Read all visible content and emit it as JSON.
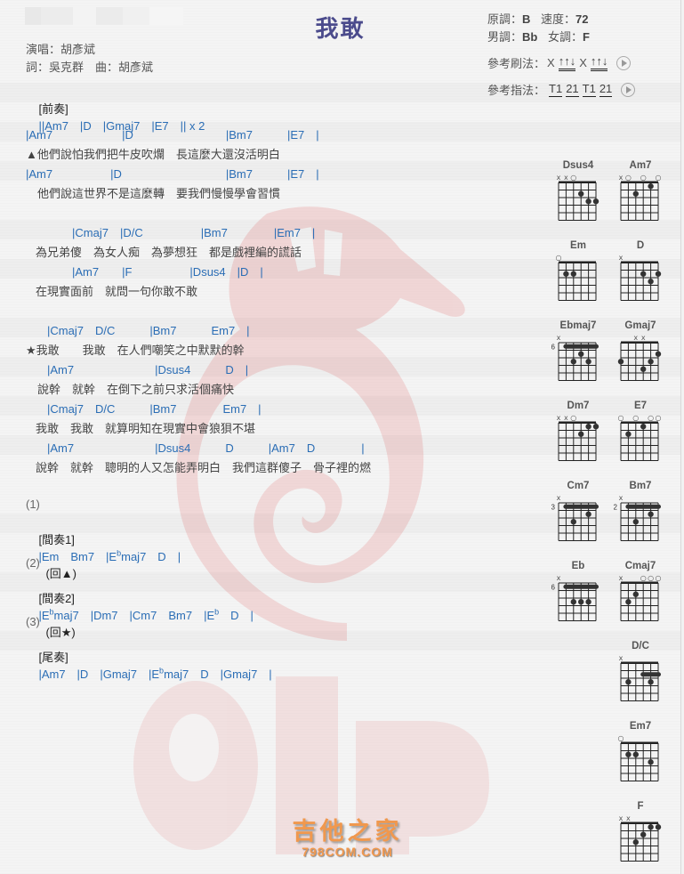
{
  "song": {
    "title": "我敢",
    "singer_line": "演唱：胡彥斌",
    "credits_line": "詞：吳克群　曲：胡彥斌"
  },
  "key_info": {
    "original_key_label": "原調：",
    "original_key": "B",
    "tempo_label": "速度：",
    "tempo": "72",
    "male_key_label": "男調：",
    "male_key": "Bb",
    "female_key_label": "女調：",
    "female_key": "F"
  },
  "strumming": {
    "label": "參考刷法：",
    "pattern": [
      "X",
      "↑↑↓",
      "X",
      "↑↑↓"
    ],
    "play_icon": "play-circle-icon"
  },
  "fingering": {
    "label": "參考指法：",
    "pattern": [
      "T1",
      "21",
      "T1",
      "21"
    ],
    "play_icon": "play-circle-icon"
  },
  "sheet": {
    "intro": {
      "label": "[前奏]",
      "chords": "||Am7　|D　|Gmaj7　|E7　|| x 2"
    },
    "verse": [
      {
        "chords": "|Am7　　　　　　|D　　　　　　　　|Bm7　　　|E7　|",
        "lyric": "▲他們說怕我們把牛皮吹爛　長這麼大還沒活明白"
      },
      {
        "chords": "|Am7　　　　　|D　　　　　　　　　|Bm7　　　|E7　|",
        "lyric": "　他們說這世界不是這麼轉　要我們慢慢學會習慣"
      },
      {
        "chords": "　　　　|Cmaj7　|D/C　　　　　|Bm7　　　　|Em7　|",
        "lyric": "為兄弟傻　為女人痴　為夢想狂　都是戲裡編的謊話"
      },
      {
        "chords": "　　　　|Am7　　|F　　　　　|Dsus4　|D　|",
        "lyric": "在現實面前　就問一句你敢不敢"
      }
    ],
    "chorus": [
      {
        "chords": "　|Cmaj7　D/C　　　|Bm7　　　Em7　|",
        "lyric": "★我敢　　我敢　在人們嘲笑之中默默的幹"
      },
      {
        "chords": "　|Am7　　　　　　　|Dsus4　　　D　|",
        "lyric": "　說幹　就幹　在倒下之前只求活個痛快"
      },
      {
        "chords": "　|Cmaj7　D/C　　　|Bm7　　　　Em7　|",
        "lyric": "我敢　我敢　就算明知在現實中會狼狽不堪"
      },
      {
        "chords": "　|Am7　　　　　　　|Dsus4　　　D　　　|Am7　D　　　　|",
        "lyric": "說幹　就幹　聰明的人又怎能弄明白　我們這群傻子　骨子裡的燃"
      }
    ],
    "interlude1": {
      "number": "(1)",
      "label": "[間奏1]",
      "chords_html_parts": [
        "|Em　Bm7　|E",
        "b",
        "maj7　D　|"
      ],
      "return_mark": "(回▲)"
    },
    "interlude2": {
      "number": "(2)",
      "label": "[間奏2]",
      "chords_html_parts": [
        "|E",
        "b",
        "maj7　|Dm7　|Cm7　Bm7　|E",
        "b",
        "　D　|"
      ],
      "return_mark": "(回★)"
    },
    "outro": {
      "number": "(3)",
      "label": "[尾奏]",
      "chords_html_parts": [
        "|Am7　|D　|Gmaj7　|E",
        "b",
        "maj7　D　|Gmaj7　|"
      ]
    }
  },
  "chord_diagrams": [
    {
      "name": "Dsus4",
      "markers": [
        "x",
        "x",
        "o",
        "",
        "",
        ""
      ],
      "base_fret": null,
      "barre": null,
      "dots": [
        [
          4,
          2
        ],
        [
          5,
          3
        ],
        [
          6,
          3
        ]
      ]
    },
    {
      "name": "Am7",
      "markers": [
        "x",
        "o",
        "",
        "o",
        "",
        "o"
      ],
      "base_fret": null,
      "barre": null,
      "dots": [
        [
          5,
          1
        ],
        [
          3,
          2
        ]
      ]
    },
    {
      "name": "Em",
      "markers": [
        "o",
        "",
        "",
        "",
        "",
        ""
      ],
      "base_fret": null,
      "barre": null,
      "dots": [
        [
          2,
          2
        ],
        [
          3,
          2
        ]
      ]
    },
    {
      "name": "D",
      "markers": [
        "x",
        "",
        "",
        "",
        "",
        ""
      ],
      "base_fret": null,
      "barre": null,
      "dots": [
        [
          4,
          2
        ],
        [
          6,
          2
        ],
        [
          5,
          3
        ]
      ]
    },
    {
      "name": "Ebmaj7",
      "markers": [
        "x",
        "",
        "",
        "",
        "",
        ""
      ],
      "base_fret": "6",
      "barre": [
        2,
        6,
        1
      ],
      "dots": [
        [
          4,
          2
        ],
        [
          3,
          3
        ],
        [
          5,
          3
        ]
      ]
    },
    {
      "name": "Gmaj7",
      "markers": [
        "",
        "",
        "x",
        "x",
        "",
        ""
      ],
      "base_fret": null,
      "barre": null,
      "dots": [
        [
          6,
          2
        ],
        [
          1,
          3
        ],
        [
          5,
          3
        ],
        [
          4,
          4
        ]
      ]
    },
    {
      "name": "Dm7",
      "markers": [
        "x",
        "x",
        "o",
        "",
        "",
        ""
      ],
      "base_fret": null,
      "barre": null,
      "dots": [
        [
          5,
          1
        ],
        [
          6,
          1
        ],
        [
          4,
          2
        ]
      ]
    },
    {
      "name": "E7",
      "markers": [
        "o",
        "",
        "o",
        "",
        "o",
        "o"
      ],
      "base_fret": null,
      "barre": null,
      "dots": [
        [
          4,
          1
        ],
        [
          2,
          2
        ]
      ]
    },
    {
      "name": "Cm7",
      "markers": [
        "x",
        "",
        "",
        "",
        "",
        ""
      ],
      "base_fret": "3",
      "barre": [
        2,
        6,
        1
      ],
      "dots": [
        [
          5,
          2
        ],
        [
          3,
          3
        ]
      ]
    },
    {
      "name": "Bm7",
      "markers": [
        "x",
        "",
        "",
        "",
        "",
        ""
      ],
      "base_fret": "2",
      "barre": [
        2,
        6,
        1
      ],
      "dots": [
        [
          5,
          2
        ],
        [
          3,
          3
        ]
      ]
    },
    {
      "name": "Eb",
      "markers": [
        "x",
        "",
        "",
        "",
        "",
        ""
      ],
      "base_fret": "6",
      "barre": [
        2,
        6,
        1
      ],
      "dots": [
        [
          3,
          3
        ],
        [
          4,
          3
        ],
        [
          5,
          3
        ]
      ]
    },
    {
      "name": "Cmaj7",
      "markers": [
        "x",
        "",
        "",
        "o",
        "o",
        "o"
      ],
      "base_fret": null,
      "barre": null,
      "dots": [
        [
          3,
          2
        ],
        [
          2,
          3
        ]
      ]
    },
    {
      "name": "D/C",
      "markers": [
        "x",
        "",
        "",
        "",
        "",
        ""
      ],
      "base_fret": null,
      "barre": [
        4,
        6,
        2
      ],
      "dots": [
        [
          2,
          3
        ],
        [
          5,
          3
        ]
      ]
    },
    {
      "name": "Em7",
      "markers": [
        "o",
        "",
        "",
        "",
        "",
        ""
      ],
      "base_fret": null,
      "barre": null,
      "dots": [
        [
          2,
          2
        ],
        [
          3,
          2
        ],
        [
          5,
          3
        ]
      ]
    },
    {
      "name": "F",
      "markers": [
        "x",
        "x",
        "",
        "",
        "",
        ""
      ],
      "base_fret": null,
      "barre": null,
      "dots": [
        [
          5,
          1
        ],
        [
          6,
          1
        ],
        [
          4,
          2
        ],
        [
          3,
          3
        ]
      ]
    }
  ],
  "watermark": {
    "site_name_cn": "吉他之家",
    "site_name_en": "798COM.COM",
    "logo_text": "91PU"
  }
}
